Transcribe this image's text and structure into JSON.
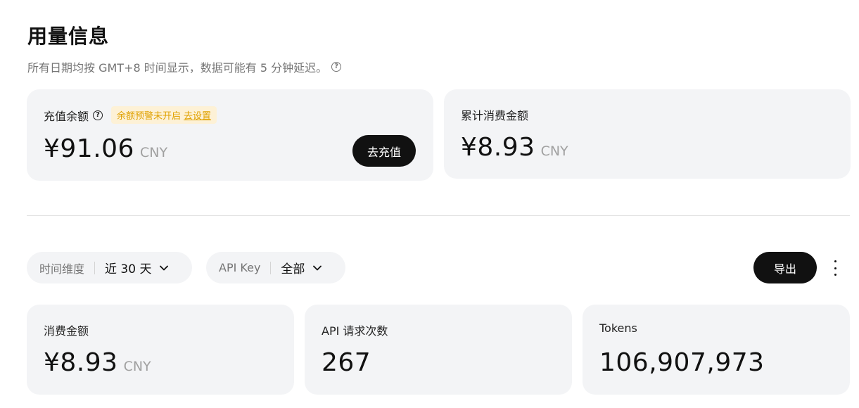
{
  "header": {
    "title": "用量信息",
    "subtitle": "所有日期均按 GMT+8 时间显示，数据可能有 5 分钟延迟。",
    "help_glyph": "?"
  },
  "balance_card": {
    "label": "充值余额",
    "help_glyph": "?",
    "warning_text": "余额预警未开启",
    "warning_link": "去设置",
    "value": "¥91.06",
    "unit": "CNY",
    "topup_label": "去充值"
  },
  "total_spend_card": {
    "label": "累计消费金额",
    "value": "¥8.93",
    "unit": "CNY"
  },
  "filters": {
    "time": {
      "key": "时间维度",
      "value": "近 30 天"
    },
    "api_key": {
      "key": "API Key",
      "value": "全部"
    }
  },
  "toolbar": {
    "export_label": "导出",
    "more_icon": "more-vertical-icon"
  },
  "stats": {
    "spend": {
      "label": "消费金额",
      "value": "¥8.93",
      "unit": "CNY"
    },
    "requests": {
      "label": "API 请求次数",
      "value": "267"
    },
    "tokens": {
      "label": "Tokens",
      "value": "106,907,973"
    }
  },
  "colors": {
    "card_bg": "#f3f4f6",
    "accent_dark": "#111111",
    "warning_text": "#e0a100",
    "warning_bg": "#fdf1d6"
  }
}
